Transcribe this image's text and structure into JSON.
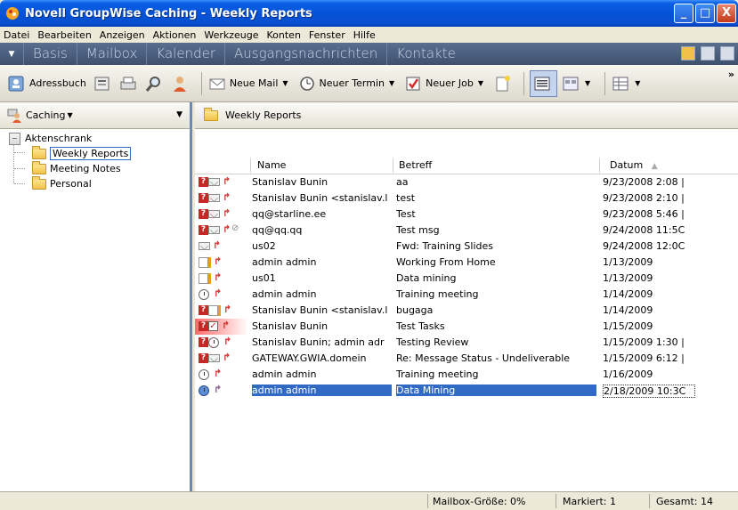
{
  "window": {
    "title": "Novell GroupWise Caching - Weekly Reports",
    "controls": {
      "minimize": "_",
      "maximize": "□",
      "close": "X"
    }
  },
  "menu": [
    "Datei",
    "Bearbeiten",
    "Anzeigen",
    "Aktionen",
    "Werkzeuge",
    "Konten",
    "Fenster",
    "Hilfe"
  ],
  "nav": {
    "dropdown_glyph": "▼",
    "tabs": [
      "Basis",
      "Mailbox",
      "Kalender",
      "Ausgangsnachrichten",
      "Kontakte"
    ]
  },
  "toolbar": {
    "address_book": "Adressbuch",
    "new_mail": "Neue Mail",
    "new_appointment": "Neuer Termin",
    "new_task": "Neuer Job",
    "overflow": "»"
  },
  "left_pane": {
    "mode_label": "Caching",
    "tree": {
      "root": "Aktenschrank",
      "children": [
        "Weekly Reports",
        "Meeting Notes",
        "Personal"
      ],
      "selected": "Weekly Reports"
    }
  },
  "right_pane": {
    "folder_title": "Weekly Reports",
    "columns": {
      "name": "Name",
      "subject": "Betreff",
      "date": "Datum",
      "sort_glyph": "▲"
    },
    "rows": [
      {
        "icons": [
          "q",
          "env",
          "arrow"
        ],
        "name": "Stanislav Bunin",
        "subject": "aa",
        "date": "9/23/2008 2:08 |"
      },
      {
        "icons": [
          "q",
          "env",
          "arrow"
        ],
        "name": "Stanislav Bunin <stanislav.l",
        "subject": "test",
        "date": "9/23/2008 2:10 |"
      },
      {
        "icons": [
          "q",
          "env",
          "arrow"
        ],
        "name": "qq@starline.ee",
        "subject": "Test",
        "date": "9/23/2008 5:46 |"
      },
      {
        "icons": [
          "q",
          "env",
          "arrow",
          "clip"
        ],
        "name": "qq@qq.qq",
        "subject": "Test msg",
        "date": "9/24/2008 11:5C"
      },
      {
        "icons": [
          "env",
          "arrow"
        ],
        "name": "us02",
        "subject": "Fwd: Training Slides",
        "date": "9/24/2008 12:0C"
      },
      {
        "icons": [
          "note",
          "arrow"
        ],
        "name": "admin admin",
        "subject": "Working From Home",
        "date": "1/13/2009"
      },
      {
        "icons": [
          "note",
          "arrow"
        ],
        "name": "us01",
        "subject": "Data mining",
        "date": "1/13/2009"
      },
      {
        "icons": [
          "clock",
          "arrow"
        ],
        "name": "admin admin",
        "subject": "Training meeting",
        "date": "1/14/2009"
      },
      {
        "icons": [
          "q",
          "note",
          "arrow"
        ],
        "name": "Stanislav Bunin <stanislav.l",
        "subject": "bugaga",
        "date": "1/14/2009"
      },
      {
        "icons": [
          "q",
          "task",
          "arrow"
        ],
        "name": "Stanislav Bunin",
        "subject": "Test Tasks",
        "date": "1/15/2009",
        "highlight": true
      },
      {
        "icons": [
          "q",
          "clock",
          "arrow"
        ],
        "name": "Stanislav Bunin; admin adr",
        "subject": "Testing Review",
        "date": "1/15/2009 1:30 |"
      },
      {
        "icons": [
          "q",
          "env",
          "arrow"
        ],
        "name": "GATEWAY.GWIA.domein",
        "subject": "Re: Message Status - Undeliverable",
        "date": "1/15/2009 6:12 |"
      },
      {
        "icons": [
          "clock",
          "arrow"
        ],
        "name": "admin admin",
        "subject": "Training meeting",
        "date": "1/16/2009"
      },
      {
        "icons": [
          "clockblue",
          "arrowgrey"
        ],
        "name": "admin admin",
        "subject": "Data Mining",
        "date": "2/18/2009 10:3C",
        "selected": true
      }
    ]
  },
  "status": {
    "mailbox_size": "Mailbox-Größe: 0%",
    "marked": "Markiert: 1",
    "total": "Gesamt: 14"
  }
}
